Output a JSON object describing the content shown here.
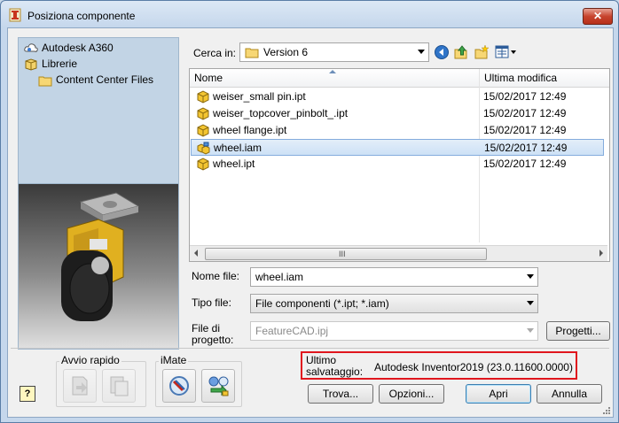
{
  "window": {
    "title": "Posiziona componente",
    "close_label": "✕"
  },
  "places": {
    "items": [
      {
        "label": "Autodesk A360",
        "icon": "cloud-icon"
      },
      {
        "label": "Librerie",
        "icon": "library-icon"
      },
      {
        "label": "Content Center Files",
        "icon": "folder-icon"
      }
    ]
  },
  "lookin": {
    "label": "Cerca in:",
    "value": "Version 6"
  },
  "filelist": {
    "columns": [
      "Nome",
      "Ultima modifica"
    ],
    "rows": [
      {
        "name": "weiser_small pin.ipt",
        "date": "15/02/2017 12:49",
        "icon": "part-icon"
      },
      {
        "name": "weiser_topcover_pinbolt_.ipt",
        "date": "15/02/2017 12:49",
        "icon": "part-icon"
      },
      {
        "name": "wheel flange.ipt",
        "date": "15/02/2017 12:49",
        "icon": "part-icon"
      },
      {
        "name": "wheel.iam",
        "date": "15/02/2017 12:49",
        "icon": "assembly-icon",
        "selected": true
      },
      {
        "name": "wheel.ipt",
        "date": "15/02/2017 12:49",
        "icon": "part-icon"
      }
    ],
    "scroll_grip": "III"
  },
  "filename": {
    "label": "Nome file:",
    "value": "wheel.iam"
  },
  "filetype": {
    "label": "Tipo file:",
    "value": "File componenti (*.ipt; *.iam)"
  },
  "project": {
    "label_line1": "File di",
    "label_line2": "progetto:",
    "value": "FeatureCAD.ipj",
    "button": "Progetti..."
  },
  "quicklaunch": {
    "title": "Avvio rapido"
  },
  "imate": {
    "title": "iMate"
  },
  "saved": {
    "label_line1": "Ultimo",
    "label_line2": "salvataggio:",
    "value": "Autodesk Inventor2019 (23.0.11600.0000)"
  },
  "buttons": {
    "find": "Trova...",
    "options": "Opzioni...",
    "open": "Apri",
    "cancel": "Annulla",
    "help": "?"
  },
  "colors": {
    "accent_highlight": "#e0161e",
    "selection": "#cde1f6"
  }
}
